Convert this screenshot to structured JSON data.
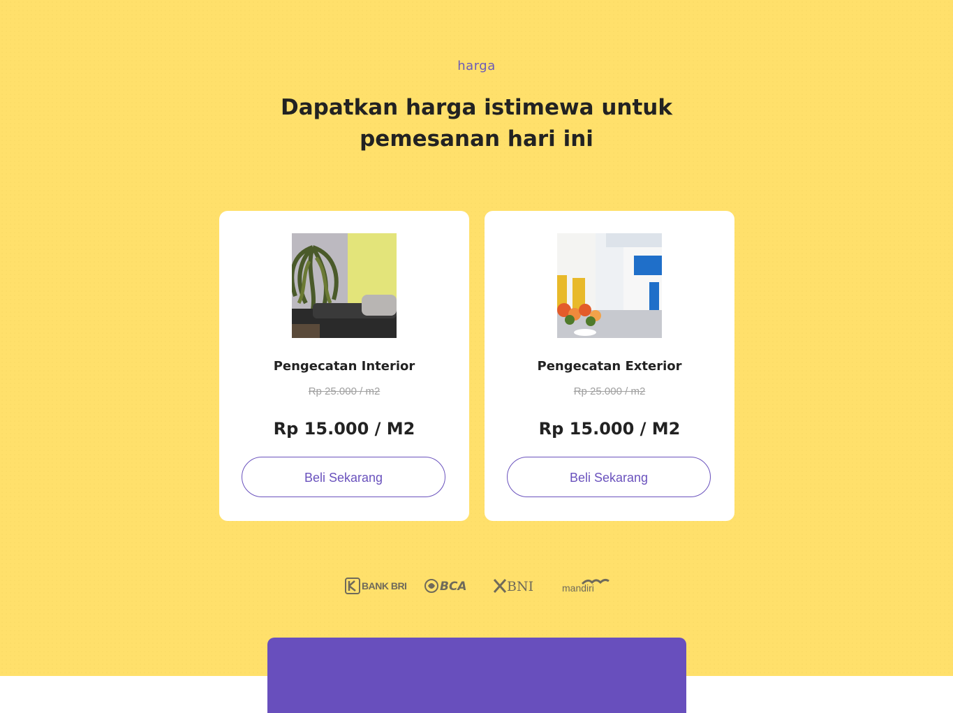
{
  "section": {
    "eyebrow": "harga",
    "headline": "Dapatkan harga istimewa untuk pemesanan hari ini"
  },
  "cards": [
    {
      "title": "Pengecatan Interior",
      "old_price": "Rp 25.000 / m2",
      "price": "Rp 15.000 / M2",
      "button_label": "Beli Sekarang"
    },
    {
      "title": "Pengecatan Exterior",
      "old_price": "Rp 25.000 / m2",
      "price": "Rp 15.000 / M2",
      "button_label": "Beli Sekarang"
    }
  ],
  "banks": [
    "BANK BRI",
    "BCA",
    "BNI",
    "mandiri"
  ],
  "colors": {
    "background": "#ffe06b",
    "accent": "#684fbd",
    "text": "#222222",
    "muted": "#a0a0a0"
  }
}
